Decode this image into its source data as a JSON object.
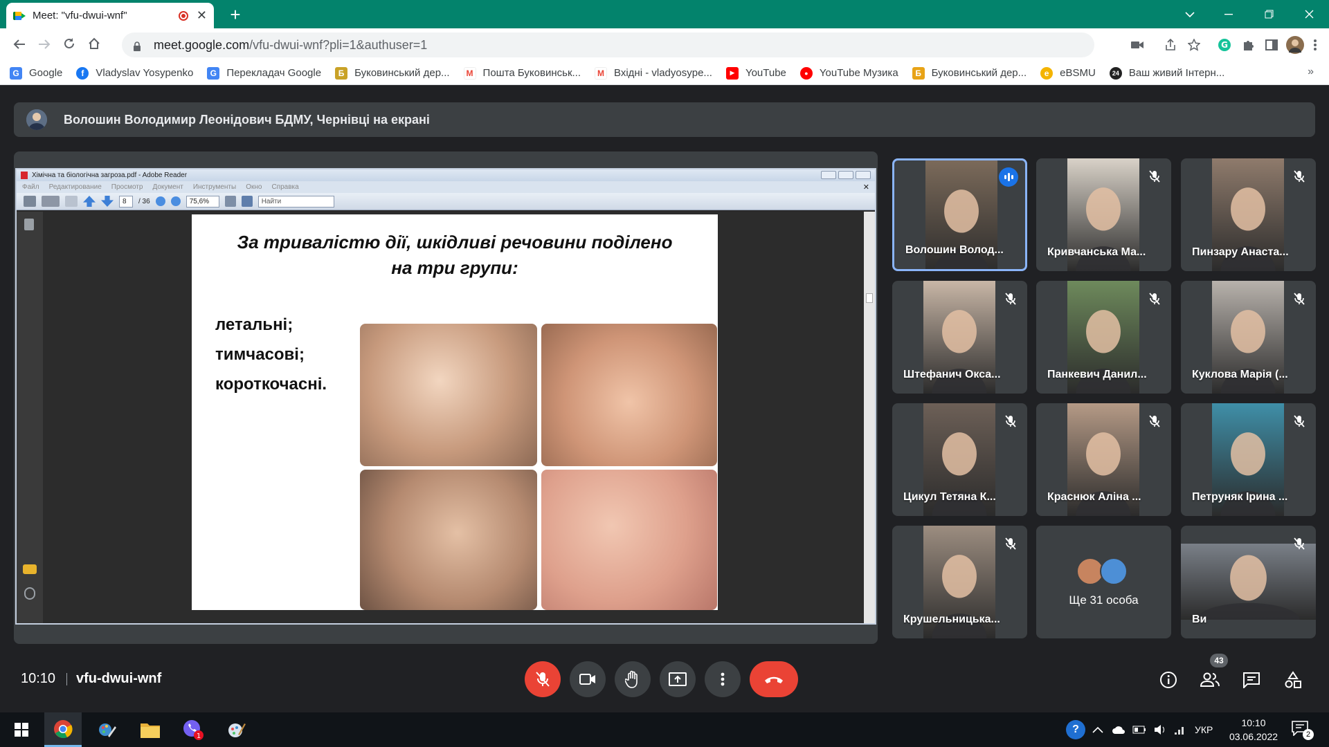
{
  "browser": {
    "tab_title": "Meet: \"vfu-dwui-wnf\"",
    "new_tab_symbol": "+",
    "url_host": "meet.google.com",
    "url_path": "/vfu-dwui-wnf?pli=1&authuser=1",
    "bookmarks": [
      {
        "label": "Google",
        "color": "#4285f4",
        "glyph": "G"
      },
      {
        "label": "Vladyslav Yosypenko",
        "color": "#1877f2",
        "glyph": "f"
      },
      {
        "label": "Перекладач Google",
        "color": "#4285f4",
        "glyph": "G"
      },
      {
        "label": "Буковинський дер...",
        "color": "#c9a227",
        "glyph": "Б"
      },
      {
        "label": "Пошта Буковинськ...",
        "color": "#ea4335",
        "glyph": "M"
      },
      {
        "label": "Вхідні - vladyosype...",
        "color": "#ea4335",
        "glyph": "M"
      },
      {
        "label": "YouTube",
        "color": "#ff0000",
        "glyph": "▶"
      },
      {
        "label": "YouTube Музика",
        "color": "#ff0000",
        "glyph": "●"
      },
      {
        "label": "Буковинський дер...",
        "color": "#e8a317",
        "glyph": "Б"
      },
      {
        "label": "eBSMU",
        "color": "#f4b400",
        "glyph": "e"
      },
      {
        "label": "Ваш живий Інтерн...",
        "color": "#222",
        "glyph": "24"
      }
    ],
    "more_bookmarks": "»"
  },
  "meet": {
    "presenter_banner": "Волошин Володимир Леонідович БДМУ, Чернівці на екрані",
    "time": "10:10",
    "meeting_code": "vfu-dwui-wnf",
    "participant_count": "43",
    "tiles": [
      {
        "name": "Волошин Волод...",
        "speaking": true,
        "bg": "#7b6a5a"
      },
      {
        "name": "Кривчанська Ма...",
        "speaking": false,
        "bg": "#d9d2c8"
      },
      {
        "name": "Пинзару Анаста...",
        "speaking": false,
        "bg": "#8f7b6c"
      },
      {
        "name": "Штефанич Окса...",
        "speaking": false,
        "bg": "#c8b6a6"
      },
      {
        "name": "Панкевич Данил...",
        "speaking": false,
        "bg": "#6e8a5c"
      },
      {
        "name": "Куклова Марія (...",
        "speaking": false,
        "bg": "#b8b2ac"
      },
      {
        "name": "Цикул Тетяна К...",
        "speaking": false,
        "bg": "#6d6057"
      },
      {
        "name": "Краснюк Аліна ...",
        "speaking": false,
        "bg": "#b59a86"
      },
      {
        "name": "Петруняк Ірина ...",
        "speaking": false,
        "bg": "#3f8fa8"
      },
      {
        "name": "Крушельницька...",
        "speaking": false,
        "bg": "#9c8d80"
      },
      {
        "name": "Ще 31 особа",
        "speaking": false,
        "bg": "#3c4043"
      },
      {
        "name": "Ви",
        "speaking": false,
        "bg": "#7a8088"
      }
    ]
  },
  "reader": {
    "window_title": "Хімічна та біологічна загроза.pdf - Adobe Reader",
    "menu": [
      "Файл",
      "Редактирование",
      "Просмотр",
      "Документ",
      "Инструменты",
      "Окно",
      "Справка"
    ],
    "page_current": "8",
    "page_total": "/ 36",
    "zoom": "75,6%",
    "search_placeholder": "Найти"
  },
  "slide": {
    "title_line1": "За тривалістю дії, шкідливі речовини поділено",
    "title_line2": "на три групи:",
    "items": [
      "летальні;",
      "тимчасові;",
      "короткочасні."
    ]
  },
  "taskbar": {
    "lang": "УКР",
    "time": "10:10",
    "date": "03.06.2022",
    "notif_count": "2",
    "viber_badge": "1"
  }
}
